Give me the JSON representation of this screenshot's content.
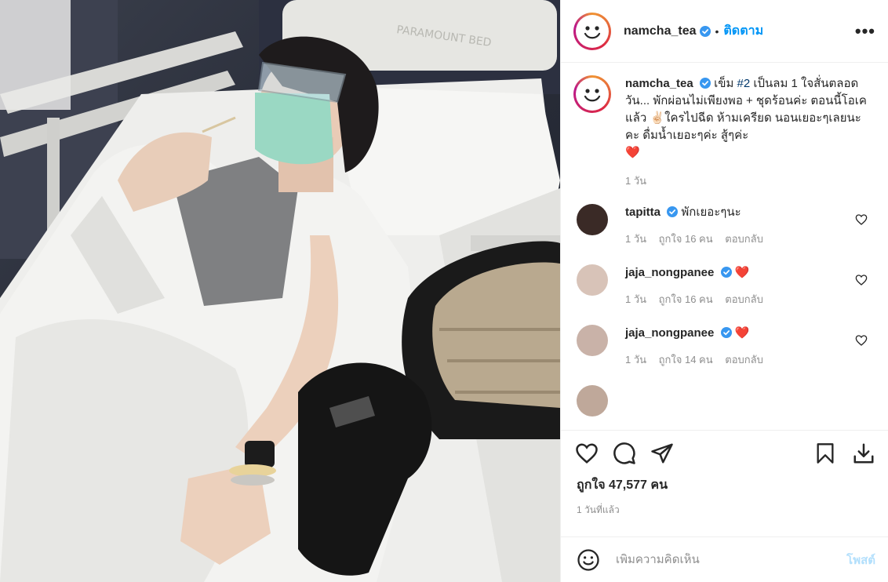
{
  "post": {
    "username": "namcha_tea",
    "follow_label": "ติดตาม",
    "more_label": "•••",
    "caption_prefix": "เข็ม ",
    "caption_hashtag": "#2",
    "caption_rest": " เป็นลม 1 ใจสั่นตลอดวัน... พักผ่อนไม่เพียงพอ + ชุดร้อนค่ะ ตอนนี้โอเคแล้ว ✌🏻ใครไปฉีด ห้ามเครียด นอนเยอะๆเลยนะคะ ดื่มน้ำเยอะๆค่ะ สู้ๆค่ะ",
    "caption_heart": "❤️",
    "caption_age": "1 วัน"
  },
  "comments": [
    {
      "username": "tapitta",
      "text": "พักเยอะๆนะ",
      "age": "1 วัน",
      "likes": "ถูกใจ 16 คน",
      "reply": "ตอบกลับ",
      "avatar_color": "#3a2a26"
    },
    {
      "username": "jaja_nongpanee",
      "text": "❤️",
      "age": "1 วัน",
      "likes": "ถูกใจ 16 คน",
      "reply": "ตอบกลับ",
      "avatar_color": "#d8c3b8"
    },
    {
      "username": "jaja_nongpanee",
      "text": "❤️",
      "age": "1 วัน",
      "likes": "ถูกใจ 14 คน",
      "reply": "ตอบกลับ",
      "avatar_color": "#c9b2a8"
    }
  ],
  "actions": {
    "icons": [
      "heart-icon",
      "comment-icon",
      "share-icon",
      "bookmark-icon",
      "download-icon"
    ]
  },
  "likes_label": "ถูกใจ 47,577 คน",
  "posted_ago": "1 วันที่แล้ว",
  "add_comment": {
    "placeholder": "เพิ่มความคิดเห็น",
    "post_label": "โพสต์"
  },
  "photo": {
    "bed_brand": "PARAMOUNT BED"
  },
  "colors": {
    "link": "#0095f6",
    "hashtag": "#00376b",
    "muted": "#8e8e8e",
    "heart": "#ed4956"
  }
}
